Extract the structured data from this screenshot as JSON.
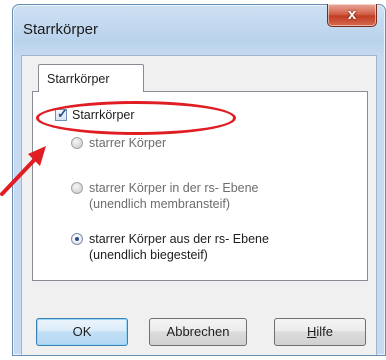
{
  "window": {
    "title": "Starrkörper",
    "close_glyph": "x"
  },
  "tabs": [
    {
      "label": "Starrkörper",
      "active": true
    }
  ],
  "panel": {
    "checkbox": {
      "label": "Starrkörper",
      "checked": true
    },
    "radios": [
      {
        "lines": [
          "starrer Körper"
        ],
        "selected": false,
        "enabled": false
      },
      {
        "lines": [
          "starrer Körper in der rs- Ebene",
          "(unendlich membransteif)"
        ],
        "selected": false,
        "enabled": false
      },
      {
        "lines": [
          "starrer Körper aus der rs- Ebene",
          "(unendlich biegesteif)"
        ],
        "selected": true,
        "enabled": true
      }
    ]
  },
  "buttons": {
    "ok": "OK",
    "cancel": "Abbrechen",
    "help_hotkey": "H",
    "help_rest": "ilfe"
  },
  "annotation": {
    "color": "#e01d22",
    "shapes": [
      "ellipse",
      "arrow"
    ]
  },
  "colors": {
    "title_bar": "#b9d2ec",
    "close_button": "#c23d24",
    "default_button_border": "#3c7fb1",
    "radio_dot": "#2c4f8f"
  }
}
